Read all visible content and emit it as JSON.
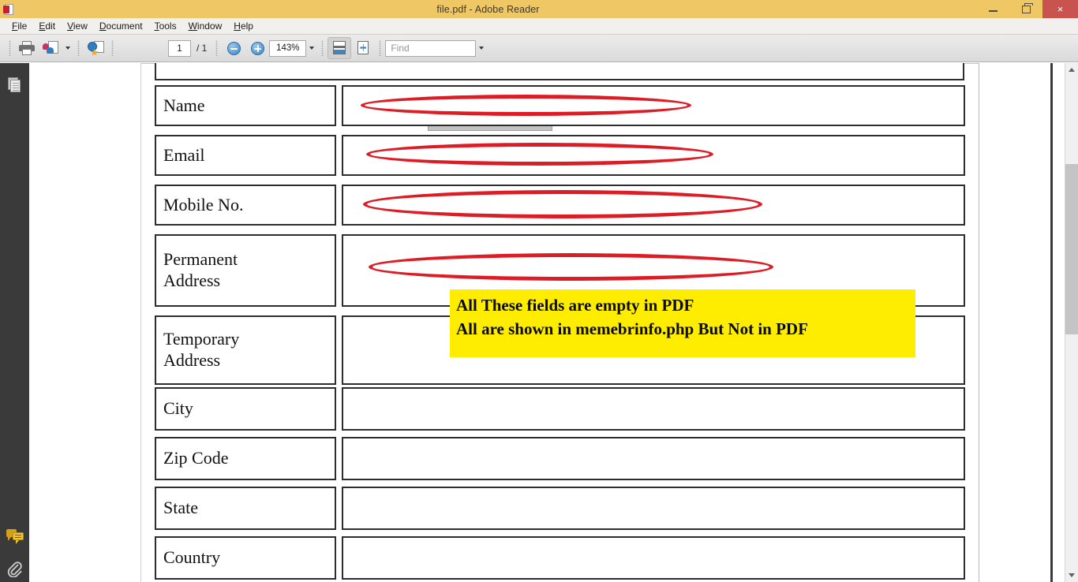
{
  "window": {
    "title": "file.pdf - Adobe Reader",
    "app_icon": "pdf-document-icon",
    "titlebar_color": "#efc765",
    "controls": [
      {
        "name": "minimize",
        "glyph": "minimize-icon"
      },
      {
        "name": "restore",
        "glyph": "restore-icon"
      },
      {
        "name": "close",
        "glyph": "close-icon",
        "label": "×",
        "color": "#c9544f"
      }
    ]
  },
  "menubar": {
    "items": [
      {
        "label": "File",
        "accel": "F"
      },
      {
        "label": "Edit",
        "accel": "E"
      },
      {
        "label": "View",
        "accel": "V"
      },
      {
        "label": "Document",
        "accel": "D"
      },
      {
        "label": "Tools",
        "accel": "T"
      },
      {
        "label": "Window",
        "accel": "W"
      },
      {
        "label": "Help",
        "accel": "H"
      }
    ]
  },
  "toolbar": {
    "print_icon": "printer-icon",
    "share_icon": "share-file-icon",
    "share_caret": "chevron-down-icon",
    "web_icon": "create-pdf-globe-icon",
    "prev_page_icon": "arrow-up-icon",
    "next_page_icon": "arrow-down-icon",
    "page_current": "1",
    "page_separator": "/ 1",
    "page_total": "1",
    "zoom_out_icon": "zoom-out-icon",
    "zoom_in_icon": "zoom-in-icon",
    "zoom_level": "143%",
    "zoom_caret": "chevron-down-icon",
    "fit_width_icon": "fit-width-icon",
    "fit_page_icon": "fit-page-icon",
    "find_placeholder": "Find",
    "find_value": "",
    "find_caret": "chevron-down-icon"
  },
  "leftnav": {
    "background": "#3a3a3a",
    "items": [
      {
        "name": "page-thumbnails",
        "icon": "pages-panel-icon"
      },
      {
        "name": "comments",
        "icon": "comments-icon"
      },
      {
        "name": "attachments",
        "icon": "paperclip-icon"
      }
    ]
  },
  "document": {
    "form_rows": [
      {
        "label": "Name",
        "value": "",
        "circled": true,
        "two_line": false
      },
      {
        "label": "Email",
        "value": "",
        "circled": true,
        "two_line": false
      },
      {
        "label": "Mobile No.",
        "value": "",
        "circled": true,
        "two_line": false
      },
      {
        "label": "Permanent\nAddress",
        "value": "",
        "circled": true,
        "two_line": true
      },
      {
        "label": "Temporary\nAddress",
        "value": "",
        "circled": false,
        "two_line": true
      },
      {
        "label": "City",
        "value": "",
        "circled": false,
        "two_line": false
      },
      {
        "label": "Zip Code",
        "value": "",
        "circled": false,
        "two_line": false
      },
      {
        "label": "State",
        "value": "",
        "circled": false,
        "two_line": false
      },
      {
        "label": "Country",
        "value": "",
        "circled": false,
        "two_line": false
      }
    ],
    "annotation_note": {
      "line1": "All These fields are empty in PDF",
      "line2": "All are shown in memebrinfo.php But Not in PDF",
      "highlight_color": "#ffed00",
      "text_color": "#0a0a0a"
    },
    "ellipse_color": "#dd1d26"
  },
  "scrollbar": {
    "up_arrow": "chevron-up-icon",
    "down_arrow": "chevron-down-icon",
    "thumb_position_percent": 20
  }
}
